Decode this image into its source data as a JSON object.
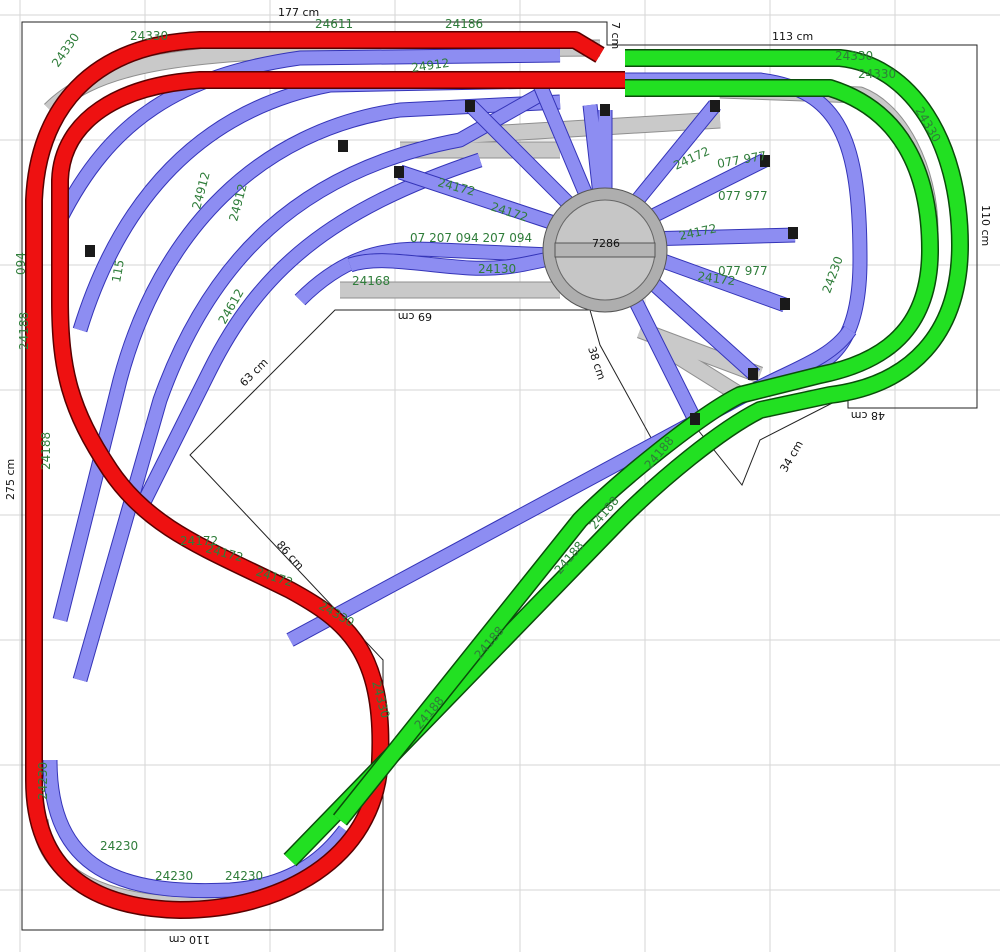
{
  "colors": {
    "background": "#ffffff",
    "grid": "#d6d6d6",
    "outline": "#222222",
    "track_blue": "#8d8df2",
    "track_gray": "#c9c9c9",
    "track_red": "#ee1111",
    "track_green": "#22e022",
    "label_green": "#2f7d3a"
  },
  "dimensions": {
    "top_width": "177 cm",
    "top_small": "7 cm",
    "right_top": "113 cm",
    "right_side": "110 cm",
    "right_bottom": "48 cm",
    "inner_top": "69 cm",
    "inner_diag_right": "38 cm",
    "inner_diag_left": "63 cm",
    "inner_diag_lower": "86 cm",
    "inner_step": "34 cm",
    "left_height": "275 cm",
    "bottom_width": "110 cm"
  },
  "turntable": {
    "code": "7286"
  },
  "part_labels": [
    "24330",
    "24330",
    "24330",
    "24330",
    "24330",
    "24330",
    "24330",
    "24172",
    "24172",
    "24172",
    "24172",
    "24172",
    "24172",
    "24172",
    "24172",
    "24188",
    "24188",
    "24188",
    "24188",
    "24188",
    "24188",
    "24188",
    "24230",
    "24230",
    "24230",
    "24230",
    "24230",
    "24912",
    "24912",
    "24912",
    "077 977",
    "077 977",
    "077 977",
    "094",
    "115",
    "07 207 094 207 094",
    "24130",
    "24168",
    "24186",
    "24611",
    "24612"
  ]
}
